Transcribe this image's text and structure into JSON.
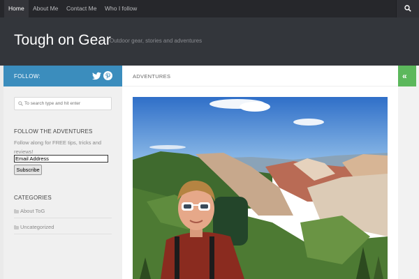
{
  "nav": {
    "items": [
      {
        "label": "Home"
      },
      {
        "label": "About Me"
      },
      {
        "label": "Contact Me"
      },
      {
        "label": "Who I follow"
      }
    ]
  },
  "header": {
    "title": "Tough on Gear",
    "tagline": "Outdoor gear, stories and adventures"
  },
  "sidebar": {
    "follow_label": "FOLLOW:",
    "search_placeholder": "To search type and hit enter",
    "subscribe": {
      "title": "FOLLOW THE ADVENTURES",
      "text": "Follow along for FREE tips, tricks and reviews!",
      "email_value": "Email Address",
      "button": "Subscribe"
    },
    "categories": {
      "title": "CATEGORIES",
      "items": [
        "About ToG",
        "Uncategorized"
      ]
    }
  },
  "main": {
    "breadcrumb": "ADVENTURES"
  },
  "colors": {
    "nav_bg": "#26272b",
    "header_bg": "#33363b",
    "follow_bar": "#3b8dbd",
    "collapse_btn": "#5cb85c"
  }
}
